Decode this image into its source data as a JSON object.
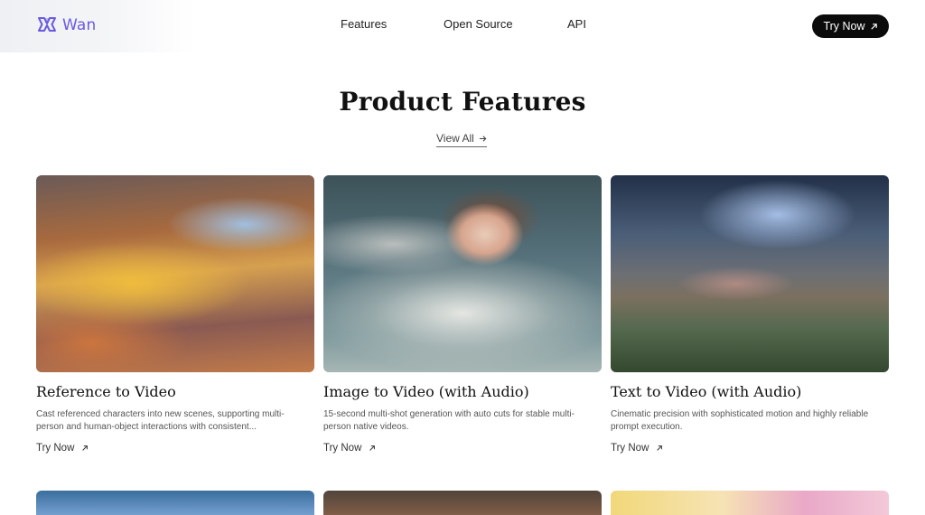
{
  "header": {
    "logo_text": "Wan",
    "nav": [
      {
        "label": "Features"
      },
      {
        "label": "Open Source"
      },
      {
        "label": "API"
      }
    ],
    "cta_label": "Try Now"
  },
  "section": {
    "title": "Product Features",
    "view_all_label": "View All"
  },
  "cards": [
    {
      "title": "Reference to Video",
      "description": "Cast referenced characters into new scenes, supporting multi-person and human-object interactions with consistent...",
      "link_label": "Try Now"
    },
    {
      "title": "Image to Video (with Audio)",
      "description": "15-second multi-shot generation with auto cuts for stable multi-person native videos.",
      "link_label": "Try Now"
    },
    {
      "title": "Text to Video (with Audio)",
      "description": "Cinematic precision with sophisticated motion and highly reliable prompt execution.",
      "link_label": "Try Now"
    }
  ],
  "colors": {
    "brand": "#6a5ae0",
    "cta_bg": "#0b0b0b",
    "text": "#111111",
    "muted": "#555555"
  },
  "icons": {
    "logo": "wan-logo-icon",
    "cta": "arrow-up-right-icon",
    "view_all": "arrow-right-icon"
  }
}
